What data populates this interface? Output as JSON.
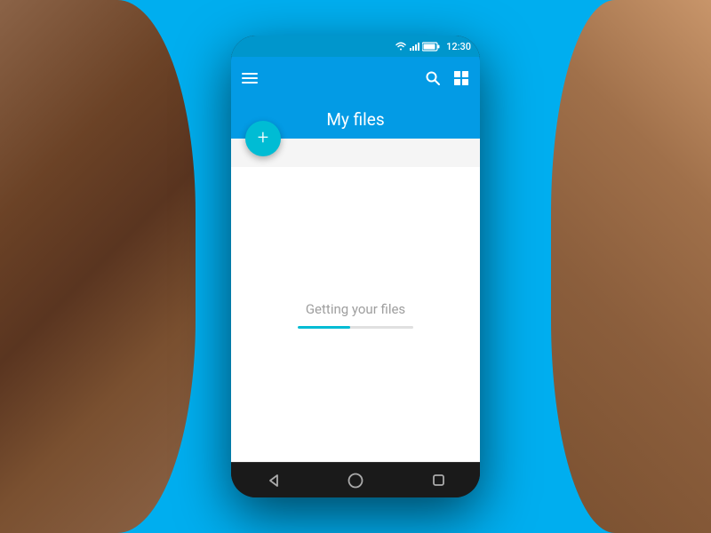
{
  "background": {
    "color": "#00AEEF"
  },
  "phone": {
    "status_bar": {
      "time": "12:30"
    },
    "app_bar": {
      "menu_icon": "hamburger-menu",
      "search_icon": "search",
      "grid_icon": "grid-view"
    },
    "title": "My files",
    "fab": {
      "label": "+",
      "aria": "Add new file"
    },
    "content": {
      "loading_text": "Getting your files"
    },
    "nav_bar": {
      "back_icon": "back-arrow",
      "home_icon": "home-circle",
      "recents_icon": "recents-square"
    }
  }
}
